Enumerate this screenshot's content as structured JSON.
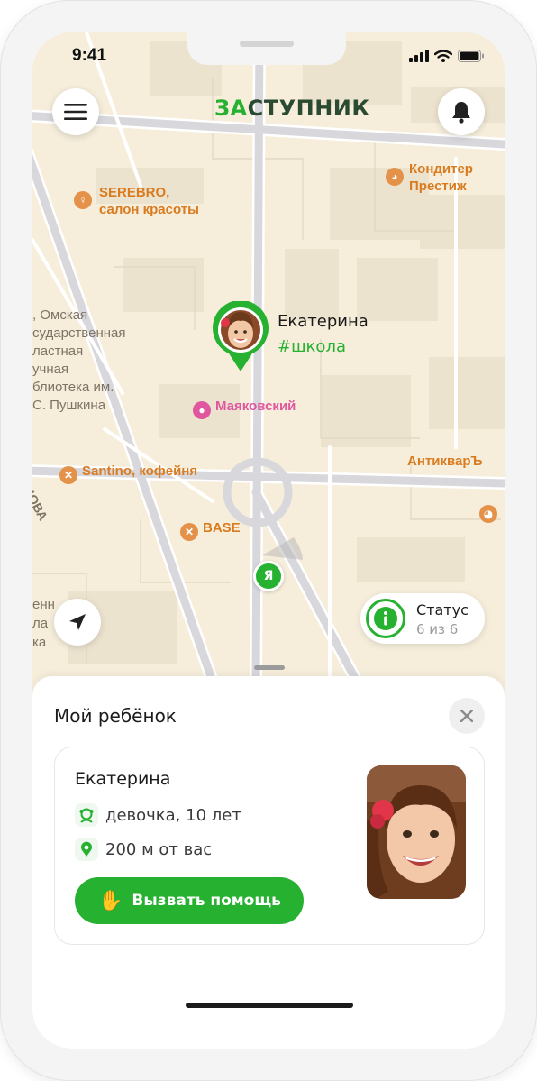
{
  "status_bar": {
    "time": "9:41"
  },
  "app": {
    "logo_accent": "ЗА",
    "logo_rest": "СТУПНИК"
  },
  "colors": {
    "accent": "#27b130",
    "map_bg": "#f6eedb"
  },
  "icons": {
    "menu": "menu-icon",
    "bell": "bell-icon",
    "locate": "navigation-arrow-icon",
    "info": "info-icon",
    "close": "close-icon",
    "girl": "girl-icon",
    "location": "location-pin-icon",
    "hand": "raised-hand-icon"
  },
  "map": {
    "labels": {
      "konditer_1": "Кондитер",
      "konditer_2": "Престиж",
      "serebro_1": "SEREBRO,",
      "serebro_2": "салон красоты",
      "library_1": ", Омская",
      "library_2": "сударственная",
      "library_3": "ластная",
      "library_4": "учная",
      "library_5": "блиотека им.",
      "library_6": "С. Пушкина",
      "mayakovsky": "Маяковский",
      "santino": "Santino, кофейня",
      "antikvar": "АнтикварЪ",
      "base": "BASE",
      "street": "ЦОВА",
      "edge_1": "енн",
      "edge_2": "ла",
      "edge_3": "ка"
    },
    "child": {
      "name": "Екатерина",
      "tag": "#школа"
    },
    "me_label": "Я"
  },
  "status_widget": {
    "title": "Статус",
    "progress": "6 из 6"
  },
  "sheet": {
    "title": "Мой ребёнок",
    "child": {
      "name": "Екатерина",
      "gender_age": "девочка, 10 лет",
      "distance": "200 м от вас"
    },
    "help_button": "Вызвать помощь"
  }
}
